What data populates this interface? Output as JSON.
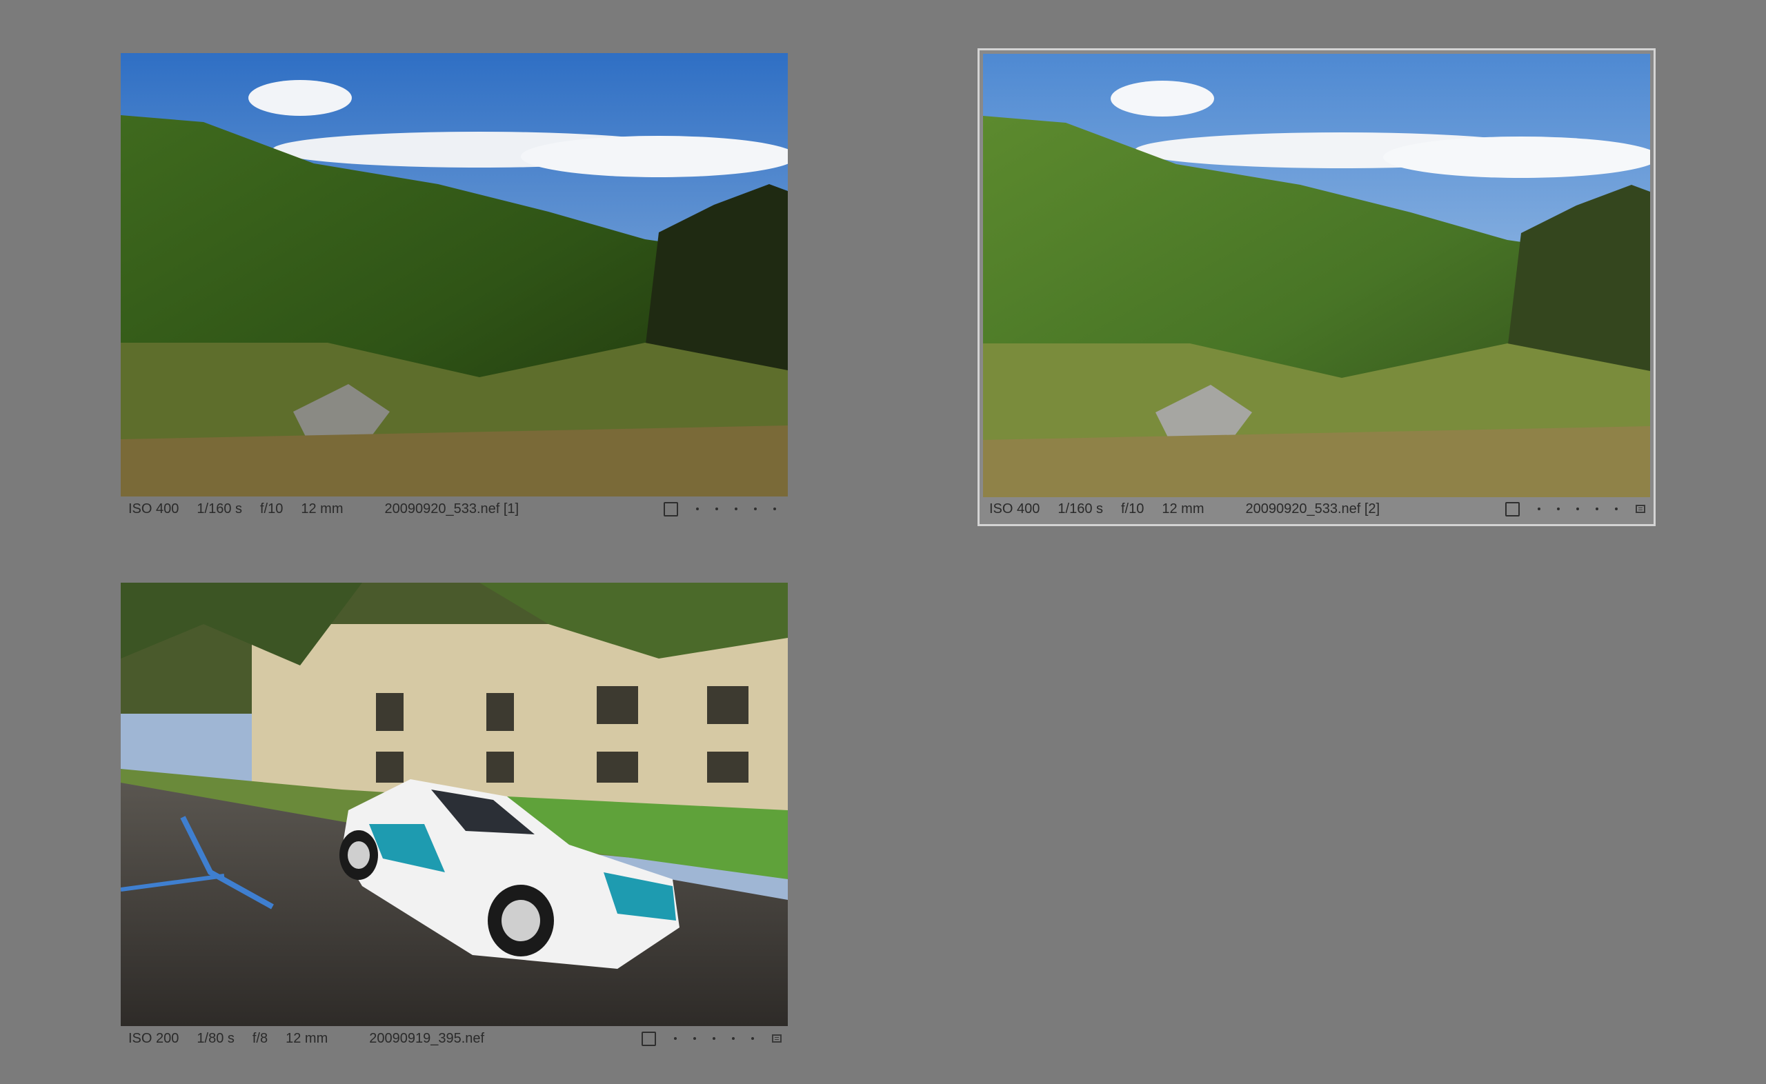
{
  "thumbnails": [
    {
      "iso": "ISO 400",
      "shutter": "1/160 s",
      "aperture": "f/10",
      "focal": "12 mm",
      "filename": "20090920_533.nef [1]",
      "selected": false,
      "edited": false,
      "rating_stars": 0,
      "image_subject": "mountain-valley"
    },
    {
      "iso": "ISO 400",
      "shutter": "1/160 s",
      "aperture": "f/10",
      "focal": "12 mm",
      "filename": "20090920_533.nef [2]",
      "selected": true,
      "edited": true,
      "rating_stars": 0,
      "image_subject": "mountain-valley"
    },
    {
      "iso": "ISO 200",
      "shutter": "1/80 s",
      "aperture": "f/8",
      "focal": "12 mm",
      "filename": "20090919_395.nef",
      "selected": false,
      "edited": true,
      "rating_stars": 0,
      "image_subject": "rally-car"
    }
  ],
  "colors": {
    "background": "#7b7b7b",
    "selected_border": "#d4d4d4",
    "text": "#2a2a2a"
  }
}
